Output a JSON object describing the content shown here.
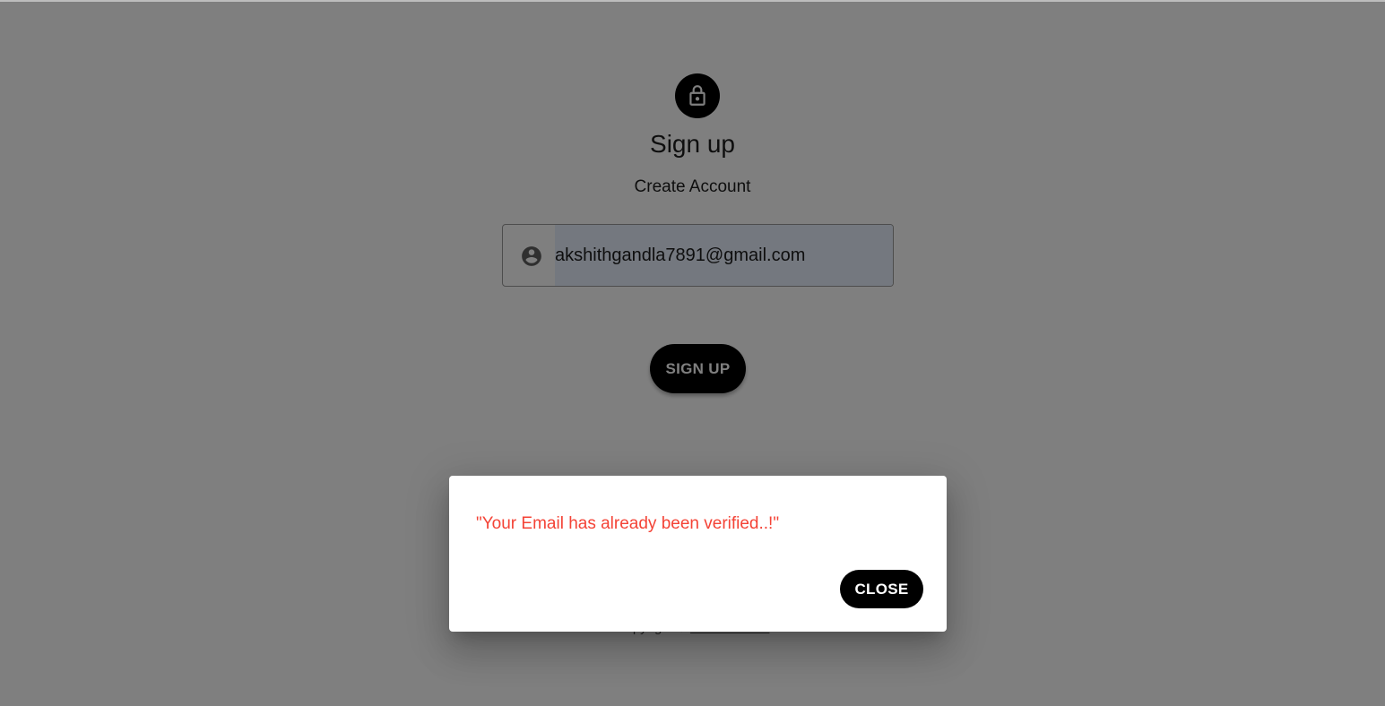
{
  "signup": {
    "title": "Sign up",
    "subtitle": "Create Account",
    "email_value": "akshithgandla7891@gmail.com",
    "submit_label": "SIGN UP",
    "icons": {
      "avatar": "lock-icon",
      "email_field": "account-circle-icon"
    }
  },
  "footer": {
    "copyright_prefix": "Copyright © ",
    "copyright_link": "Your Website"
  },
  "dialog": {
    "message": "\"Your Email has already been verified..!\"",
    "close_label": "CLOSE",
    "message_color": "#f44336"
  },
  "colors": {
    "primary": "#000000",
    "backdrop": "rgba(0,0,0,0.5)",
    "autofill": "#e8f0fe"
  }
}
